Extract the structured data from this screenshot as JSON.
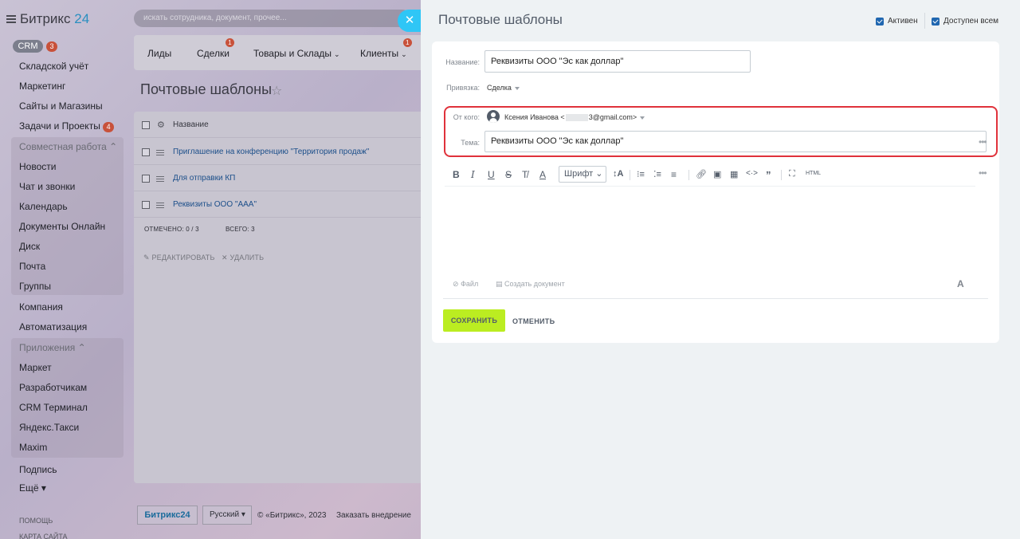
{
  "app": {
    "logo_name": "Битрикс",
    "logo_num": "24"
  },
  "sidebar": {
    "crm_label": "CRM",
    "crm_badge": "3",
    "items": [
      {
        "label": "Складской учёт"
      },
      {
        "label": "Маркетинг"
      },
      {
        "label": "Сайты и Магазины"
      },
      {
        "label": "Задачи и Проекты",
        "badge": "4"
      },
      {
        "label": "Совместная работа",
        "group": true
      },
      {
        "label": "Новости"
      },
      {
        "label": "Чат и звонки"
      },
      {
        "label": "Календарь"
      },
      {
        "label": "Документы Онлайн"
      },
      {
        "label": "Диск"
      },
      {
        "label": "Почта"
      },
      {
        "label": "Группы"
      },
      {
        "label": "Компания"
      },
      {
        "label": "Автоматизация"
      },
      {
        "label": "Приложения",
        "group": true
      },
      {
        "label": "Маркет"
      },
      {
        "label": "Разработчикам"
      },
      {
        "label": "CRM Терминал"
      },
      {
        "label": "Яндекс.Такси"
      },
      {
        "label": "Maxim"
      },
      {
        "label": "Подпись"
      },
      {
        "label": "Ещё"
      }
    ],
    "help": "ПОМОЩЬ",
    "sitemap": "КАРТА САЙТА"
  },
  "search": {
    "placeholder": "искать сотрудника, документ, прочее..."
  },
  "top_tabs": [
    {
      "label": "Лиды"
    },
    {
      "label": "Сделки",
      "badge": "1"
    },
    {
      "label": "Товары и Склады"
    },
    {
      "label": "Клиенты",
      "badge": "1"
    }
  ],
  "bg_page": {
    "title": "Почтовые шаблоны",
    "column_name": "Название",
    "rows": [
      {
        "name": "Приглашение на конференцию \"Территория продаж\""
      },
      {
        "name": "Для отправки КП"
      },
      {
        "name": "Реквизиты ООО \"ААА\""
      }
    ],
    "selected": "ОТМЕЧЕНО: 0 / 3",
    "total": "ВСЕГО: 3",
    "edit": "РЕДАКТИРОВАТЬ",
    "delete": "УДАЛИТЬ"
  },
  "footer": {
    "logo": "Битрикс24",
    "lang": "Русский",
    "copyright": "© «Битрикс», 2023",
    "order": "Заказать внедрение"
  },
  "slider": {
    "title": "Почтовые шаблоны",
    "active_label": "Активен",
    "shared_label": "Доступен всем",
    "name_label": "Название:",
    "name_value": "Реквизиты ООО \"Эс как доллар\"",
    "link_label": "Привязка:",
    "link_value": "Сделка",
    "from_label": "От кого:",
    "from_name": "Ксения Иванова <",
    "from_email_tail": "3@gmail.com>",
    "subject_label": "Тема:",
    "subject_value": "Реквизиты ООО \"Эс как доллар\"",
    "font_label": "Шрифт",
    "html_label": "HTML",
    "file_label": "Файл",
    "create_doc_label": "Создать документ",
    "save_label": "СОХРАНИТЬ",
    "cancel_label": "ОТМЕНИТЬ"
  }
}
